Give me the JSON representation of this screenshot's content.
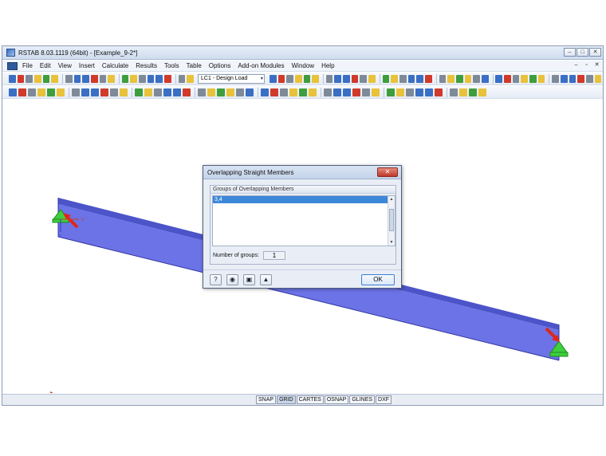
{
  "window": {
    "title": "RSTAB 8.03.1119 (64bit) - [Example_9-2*]",
    "controls": [
      "–",
      "□",
      "✕"
    ]
  },
  "menu": {
    "items": [
      "File",
      "Edit",
      "View",
      "Insert",
      "Calculate",
      "Results",
      "Tools",
      "Table",
      "Options",
      "Add-on Modules",
      "Window",
      "Help"
    ],
    "mdi_controls": [
      "–",
      "▫",
      "✕"
    ]
  },
  "toolbar": {
    "load_case": "LC1 - Design Load",
    "dropdown_arrow": "▾",
    "colors": {
      "blue": "#3a6fc4",
      "yellow": "#e8c23a",
      "red": "#d03a2a",
      "gray": "#7f8a99",
      "green": "#3e9e3e"
    }
  },
  "axes": {
    "x": "x",
    "z": "z"
  },
  "statusbar": {
    "buttons": [
      "SNAP",
      "GRID",
      "CARTES",
      "OSNAP",
      "GLINES",
      "DXF"
    ],
    "active": "GRID"
  },
  "dialog": {
    "title": "Overlapping Straight Members",
    "close": "✕",
    "group_label": "Groups of Overlapping Members",
    "rows": [
      "3,4"
    ],
    "count_label": "Number of groups:",
    "count_value": "1",
    "footer_buttons": [
      {
        "name": "help-icon",
        "glyph": "?"
      },
      {
        "name": "view-icon",
        "glyph": "◉"
      },
      {
        "name": "select-icon",
        "glyph": "▣"
      },
      {
        "name": "export-icon",
        "glyph": "▲"
      }
    ],
    "ok_label": "OK",
    "scroll_up": "▲",
    "scroll_down": "▼"
  }
}
